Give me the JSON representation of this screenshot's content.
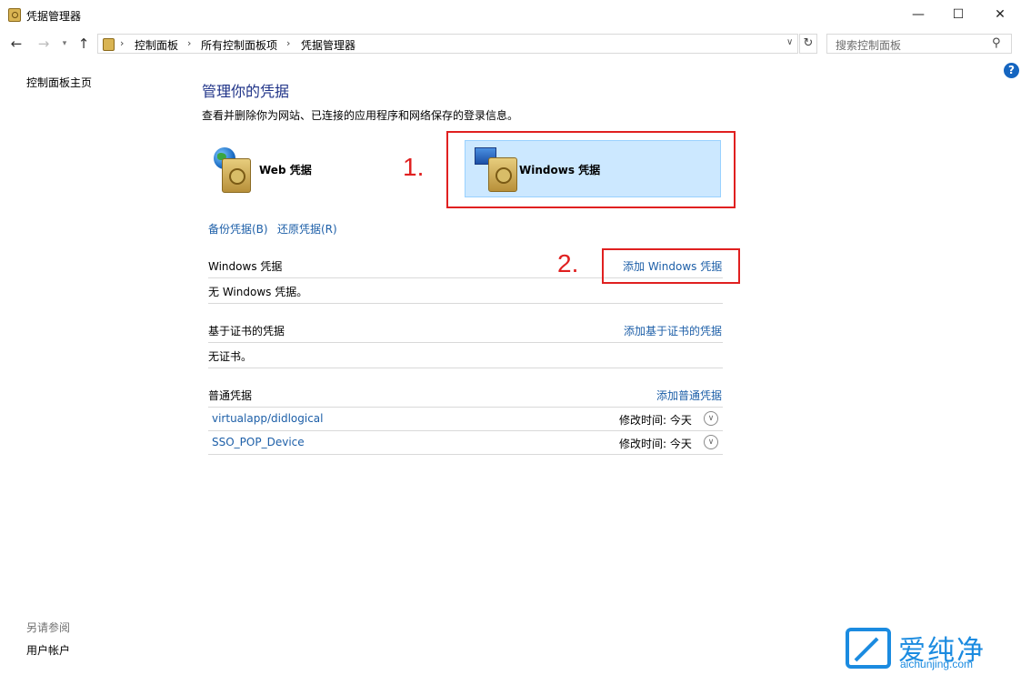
{
  "window": {
    "title": "凭据管理器",
    "min_glyph": "—",
    "max_glyph": "☐",
    "close_glyph": "✕"
  },
  "address": {
    "crumbs": [
      "控制面板",
      "所有控制面板项",
      "凭据管理器"
    ],
    "search_placeholder": "搜索控制面板"
  },
  "sidebar": {
    "home": "控制面板主页",
    "see_also": "另请参阅",
    "user_accounts": "用户帐户"
  },
  "main": {
    "title": "管理你的凭据",
    "description": "查看并删除你为网站、已连接的应用程序和网络保存的登录信息。",
    "web_credentials": "Web 凭据",
    "windows_credentials": "Windows 凭据",
    "backup_link": "备份凭据(B)",
    "restore_link": "还原凭据(R)"
  },
  "sections": {
    "windows": {
      "heading": "Windows 凭据",
      "add_link": "添加 Windows 凭据",
      "empty_text": "无 Windows 凭据。"
    },
    "certificate": {
      "heading": "基于证书的凭据",
      "add_link": "添加基于证书的凭据",
      "empty_text": "无证书。"
    },
    "generic": {
      "heading": "普通凭据",
      "add_link": "添加普通凭据",
      "items": [
        {
          "name": "virtualapp/didlogical",
          "modified": "修改时间: 今天"
        },
        {
          "name": "SSO_POP_Device",
          "modified": "修改时间: 今天"
        }
      ]
    }
  },
  "annotations": {
    "step1": "1.",
    "step2": "2."
  },
  "watermark": {
    "text": "爱纯净",
    "url": "aichunjing.com"
  },
  "colors": {
    "link": "#1d5fa8",
    "title": "#1e3287",
    "selected_bg": "#cce8ff",
    "annotation": "#e02020"
  }
}
